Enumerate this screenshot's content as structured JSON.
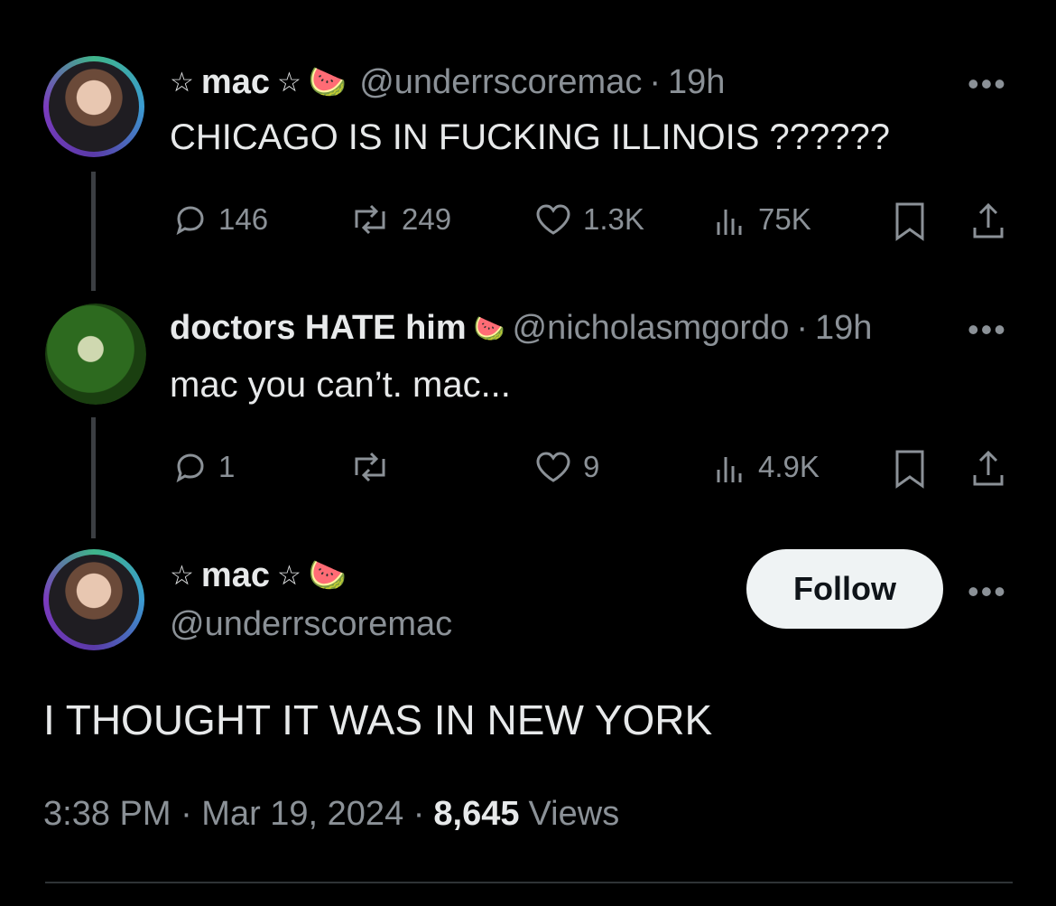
{
  "tweets": [
    {
      "name": "mac",
      "handle": "@underrscoremac",
      "time": "19h",
      "text": "CHICAGO IS IN FUCKING ILLINOIS ??????",
      "replies": "146",
      "reposts": "249",
      "likes": "1.3K",
      "views": "75K"
    },
    {
      "name": "doctors HATE him",
      "handle": "@nicholasmgordo",
      "time": "19h",
      "text": "mac you can’t. mac...",
      "replies": "1",
      "reposts": "",
      "likes": "9",
      "views": "4.9K"
    }
  ],
  "main": {
    "name": "mac",
    "handle": "@underrscoremac",
    "follow_label": "Follow",
    "text": "I THOUGHT IT WAS IN NEW YORK",
    "timestamp": "3:38 PM · Mar 19, 2024 ·",
    "views_count": "8,645",
    "views_label": "Views"
  },
  "symbols": {
    "star": "☆",
    "melon": "🍉",
    "more": "•••"
  },
  "icons": [
    "reply-icon",
    "repost-icon",
    "like-icon",
    "views-icon",
    "bookmark-icon",
    "share-icon",
    "more-icon",
    "watermelon-icon",
    "star-icon"
  ]
}
